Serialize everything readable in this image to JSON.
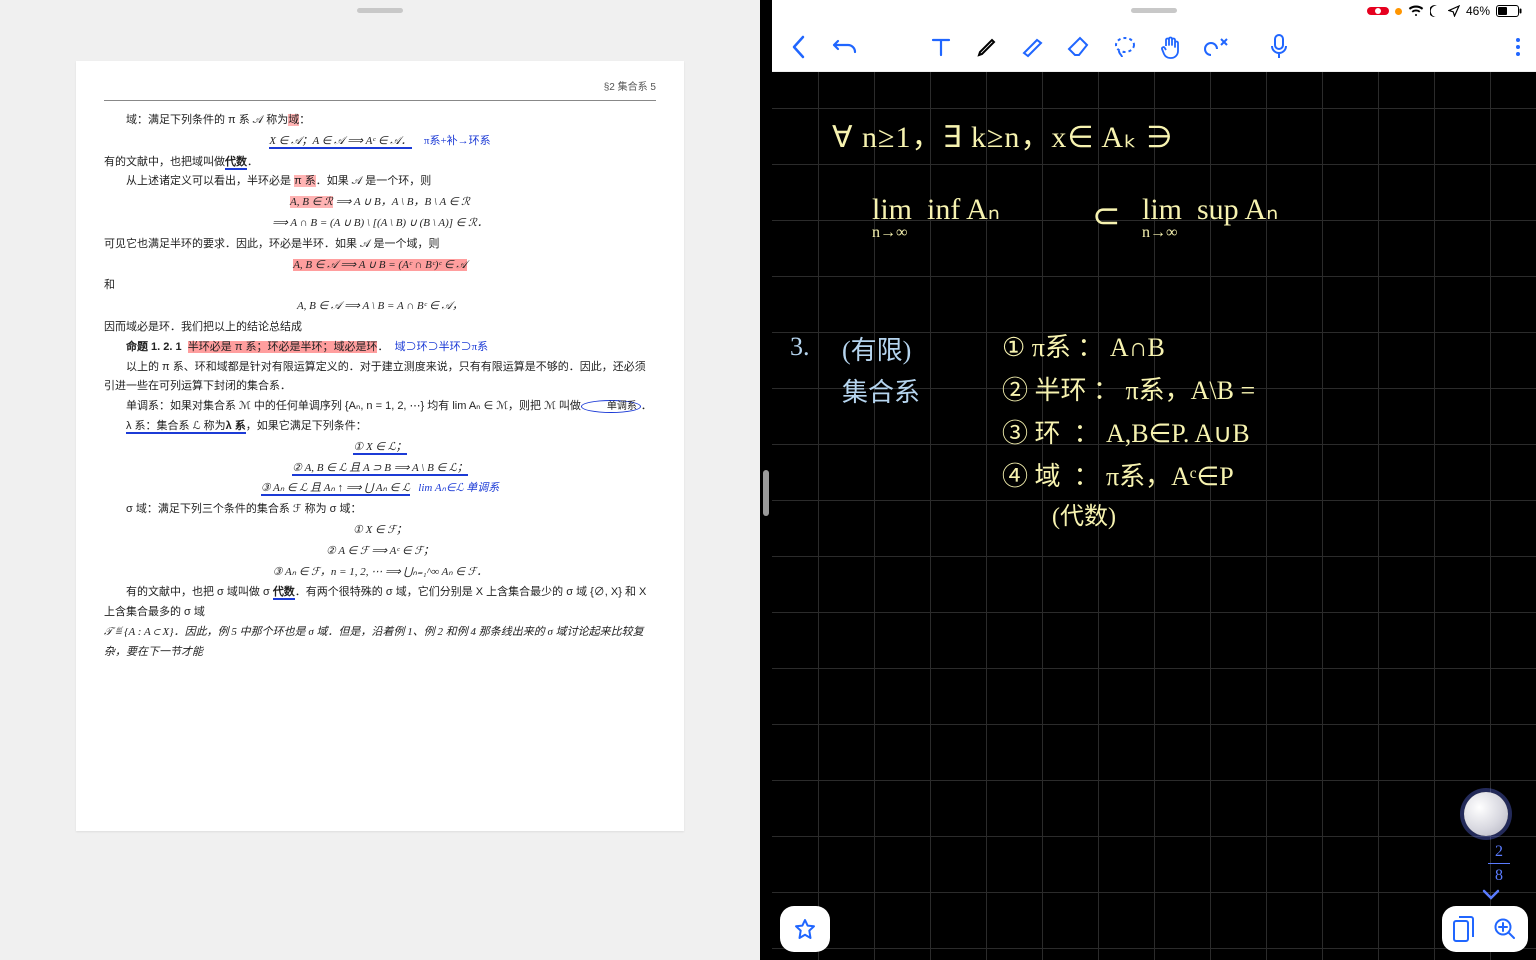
{
  "status": {
    "recording": "",
    "battery": "46%",
    "wifi": true,
    "dnd": true,
    "location": true
  },
  "pdf": {
    "running_head": "§2  集合系   5",
    "lines": {
      "l01": "域：满足下列条件的 π 系 𝒜 称为",
      "l01b": "域",
      "l02_math": "X ∈ 𝒜；A ∈ 𝒜 ⟹ Aᶜ ∈ 𝒜．",
      "l02_note": "π系+补→环系",
      "l03a": "有的文献中，也把域叫做",
      "l03b": "代数",
      "l03c": "．",
      "l04": "从上述诸定义可以看出，半环必是 ",
      "l04_hl": "π 系",
      "l04b": "．如果 𝒜 是一个环，则",
      "l05_hl": "A, B ∈ ℛ",
      "l05b": " ⟹ A ∪ B，A \\ B，B \\ A ∈ ℛ",
      "l06": "⟹ A ∩ B = (A ∪ B) \\ [(A \\ B) ∪ (B \\ A)] ∈ ℛ．",
      "l07": "可见它也满足半环的要求．因此，环必是半环．如果 𝒜 是一个域，则",
      "l08_hl": "A, B ∈ 𝒜 ⟹ A ∪ B = (Aᶜ ∩ Bᶜ)ᶜ ∈ 𝒜",
      "l09": "和",
      "l10": "A, B ∈ 𝒜 ⟹ A \\ B = A ∩ Bᶜ ∈ 𝒜，",
      "l11": "因而域必是环．我们把以上的结论总结成",
      "prop_label": "命题 1. 2. 1",
      "prop_hl": "半环必是 π 系；环必是半环；域必是环",
      "prop_note": "域⊃环⊃半环⊃π系",
      "l13": "以上的 π 系、环和域都是针对有限运算定义的．对于建立测度来说，只有有限运算是不够的．因此，还必须引进一些在可列运算下封闭的集合系．",
      "l14a": "单调系：如果对集合系 ℳ 中的任何单调序列 {Aₙ, n = 1, 2, ⋯} 均有 lim Aₙ ∈ ℳ，则把 ℳ 叫做",
      "l14b": "单调系",
      "l15a": "λ 系：集合系 ℒ 称为",
      "l15b": "λ 系",
      "l15c": "，如果它满足下列条件：",
      "c1": "① X ∈ ℒ；",
      "c2": "② A, B ∈ ℒ 且 A ⊃ B ⟹ A \\ B ∈ ℒ；",
      "c3a": "③ Aₙ ∈ ℒ 且 Aₙ ↑ ⟹ ",
      "c3b": "⋃ Aₙ ∈ ℒ",
      "c3_note": "lim Aₙ∈ℒ 单调系",
      "sigma1": "σ 域：满足下列三个条件的集合系 ℱ 称为 σ 域：",
      "s1": "① X ∈ ℱ；",
      "s2": "② A ∈ ℱ ⟹ Aᶜ ∈ ℱ；",
      "s3": "③ Aₙ ∈ ℱ，n = 1, 2, ⋯ ⟹ ⋃ₙ₌₁^∞ Aₙ ∈ ℱ．",
      "l20a": "有的文献中，也把 σ 域叫做 σ ",
      "l20b": "代数",
      "l20c": "．有两个很特殊的 σ 域，它们分别是 X 上含集合最少的 σ 域 {∅, X} 和 X 上含集合最多的 σ 域",
      "l21": "𝒯 ≝ {A : A ⊂ X}．因此，例 5 中那个环也是 σ 域．但是，沿着例 1、例 2 和例 4 那条线出来的 σ 域讨论起来比较复杂，要在下一节才能"
    }
  },
  "notes": {
    "scribble_top": "∀ n≥1，∃ k≥n，x∈ Aₖ ∋",
    "line2_l": "lim  inf Aₙ",
    "line2_sub_l": "n→∞",
    "line2_mid": "⊂",
    "line2_r": "lim  sup Aₙ",
    "line2_sub_r": "n→∞",
    "sec3_num": "3.",
    "sec3_t1": "(有限)",
    "sec3_t2": "集合系",
    "r1": "① π系 ： A∩B",
    "r2": "② 半环 ： π系，A\\B =",
    "r3": "③ 环  ： A,B∈P. A∪B",
    "r4": "④ 域  ： π系，Aᶜ∈P",
    "r5": "(代数)"
  },
  "pager": {
    "current": "2",
    "total": "8"
  }
}
